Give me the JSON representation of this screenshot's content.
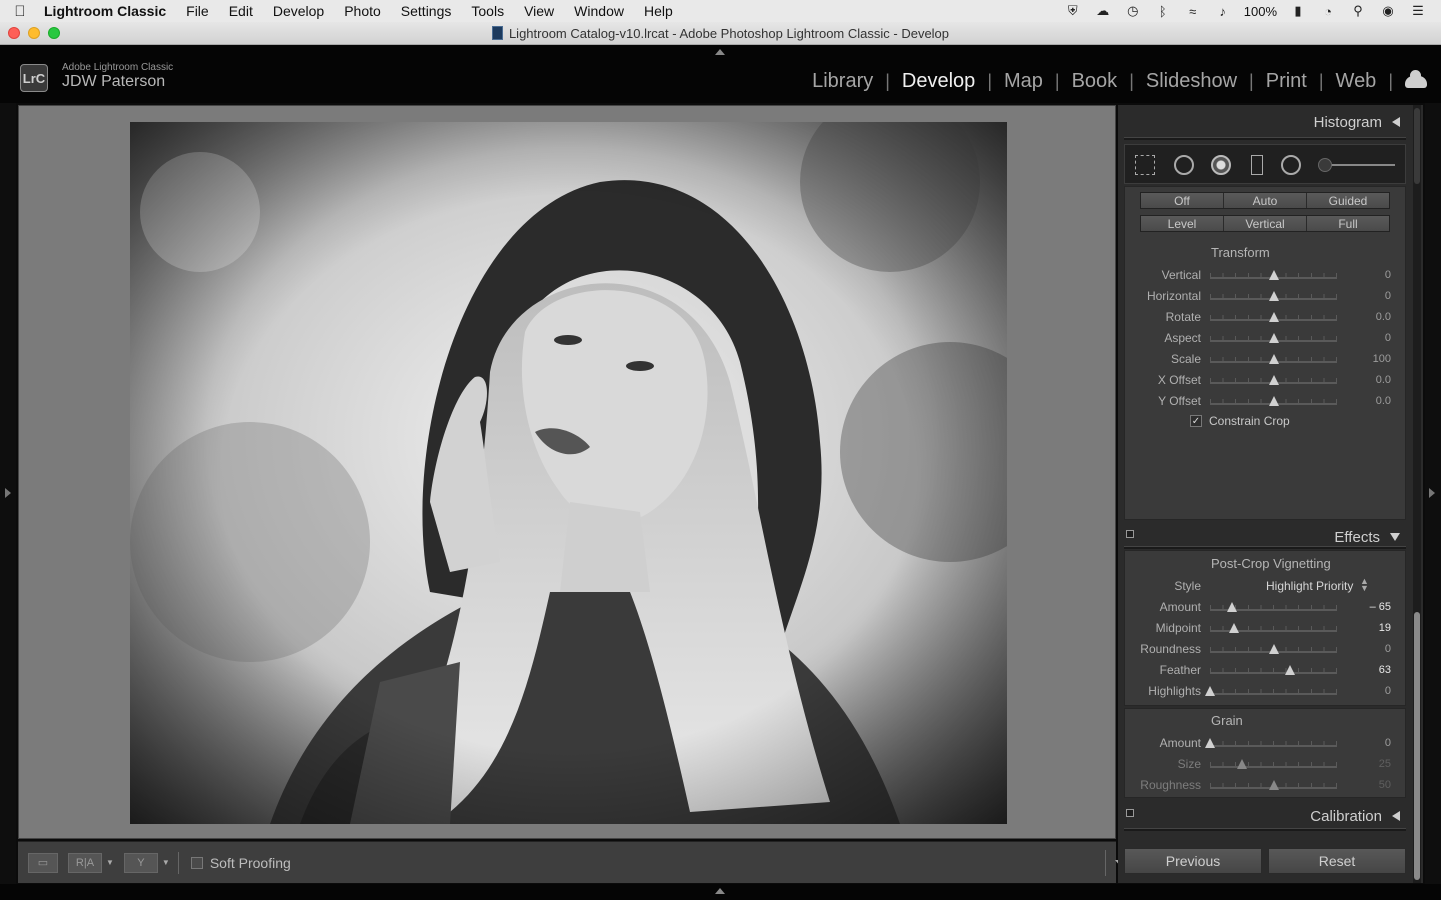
{
  "menubar": {
    "apple_icon": "apple-icon",
    "app_name": "Lightroom Classic",
    "items": [
      "File",
      "Edit",
      "Develop",
      "Photo",
      "Settings",
      "Tools",
      "View",
      "Window",
      "Help"
    ],
    "battery": "100%"
  },
  "window": {
    "title": "Lightroom Catalog-v10.lrcat - Adobe Photoshop Lightroom Classic - Develop"
  },
  "identity": {
    "badge": "LrC",
    "product": "Adobe Lightroom Classic",
    "user": "JDW Paterson"
  },
  "modules": {
    "items": [
      "Library",
      "Develop",
      "Map",
      "Book",
      "Slideshow",
      "Print",
      "Web"
    ],
    "active": "Develop"
  },
  "toolbar": {
    "ra_label": "R|A",
    "y_label": "Y",
    "soft_proofing": "Soft Proofing"
  },
  "panels": {
    "histogram": {
      "title": "Histogram"
    },
    "transform": {
      "upright_row1": [
        "Off",
        "Auto",
        "Guided"
      ],
      "upright_row2": [
        "Level",
        "Vertical",
        "Full"
      ],
      "title": "Transform",
      "rows": [
        {
          "label": "Vertical",
          "value": "0",
          "pos": 0.5
        },
        {
          "label": "Horizontal",
          "value": "0",
          "pos": 0.5
        },
        {
          "label": "Rotate",
          "value": "0.0",
          "pos": 0.5
        },
        {
          "label": "Aspect",
          "value": "0",
          "pos": 0.5
        },
        {
          "label": "Scale",
          "value": "100",
          "pos": 0.5
        },
        {
          "label": "X Offset",
          "value": "0.0",
          "pos": 0.5
        },
        {
          "label": "Y Offset",
          "value": "0.0",
          "pos": 0.5
        }
      ],
      "constrain_crop": "Constrain Crop",
      "constrain_checked": true
    },
    "effects": {
      "title": "Effects",
      "vignette_title": "Post-Crop Vignetting",
      "style_label": "Style",
      "style_value": "Highlight Priority",
      "vignette_rows": [
        {
          "label": "Amount",
          "value": "– 65",
          "pos": 0.175,
          "state": "changed"
        },
        {
          "label": "Midpoint",
          "value": "19",
          "pos": 0.19,
          "state": "changed"
        },
        {
          "label": "Roundness",
          "value": "0",
          "pos": 0.5,
          "state": "default"
        },
        {
          "label": "Feather",
          "value": "63",
          "pos": 0.63,
          "state": "changed"
        },
        {
          "label": "Highlights",
          "value": "0",
          "pos": 0.0,
          "state": "default"
        }
      ],
      "grain_title": "Grain",
      "grain_rows": [
        {
          "label": "Amount",
          "value": "0",
          "pos": 0.0,
          "state": "default"
        },
        {
          "label": "Size",
          "value": "25",
          "pos": 0.25,
          "state": "disabled"
        },
        {
          "label": "Roughness",
          "value": "50",
          "pos": 0.5,
          "state": "disabled"
        }
      ]
    },
    "calibration": {
      "title": "Calibration"
    }
  },
  "buttons": {
    "previous": "Previous",
    "reset": "Reset"
  }
}
